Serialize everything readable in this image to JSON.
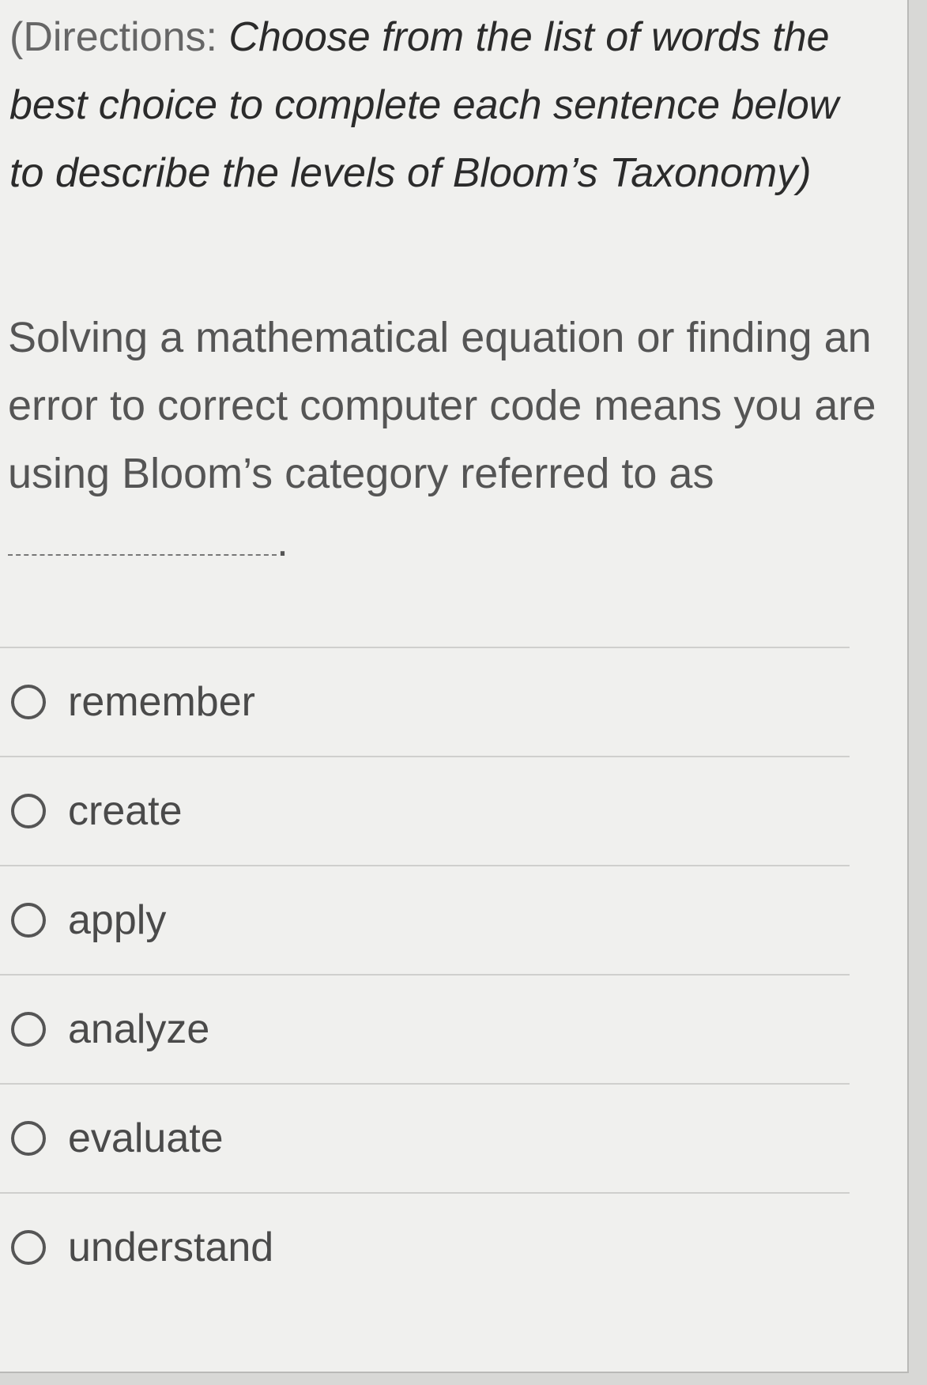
{
  "directions": {
    "open_paren": "(",
    "label": "Directions:",
    "text": "Choose from the list of words the best choice to complete each sentence below to describe the levels of Bloom’s Taxonomy)"
  },
  "question": {
    "text": "Solving a mathematical equation or finding an error to correct computer code means you are using Bloom’s category referred to as",
    "end_punct": "."
  },
  "options": [
    {
      "label": "remember",
      "selected": false
    },
    {
      "label": "create",
      "selected": false
    },
    {
      "label": "apply",
      "selected": false
    },
    {
      "label": "analyze",
      "selected": false
    },
    {
      "label": "evaluate",
      "selected": false
    },
    {
      "label": "understand",
      "selected": false
    }
  ]
}
